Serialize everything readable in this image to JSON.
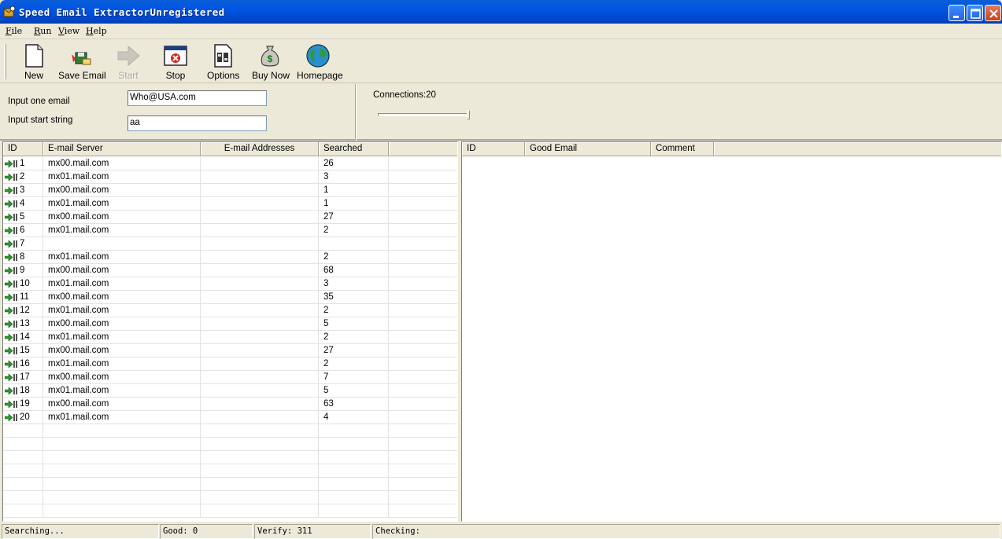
{
  "window": {
    "title": "Speed Email ExtractorUnregistered",
    "icon": "app-icon",
    "controls": [
      "minimize-icon",
      "maximize-icon",
      "close-icon"
    ]
  },
  "menu": [
    {
      "key": "F",
      "rest": "ile"
    },
    {
      "key": "R",
      "rest": "un"
    },
    {
      "key": "V",
      "rest": "iew"
    },
    {
      "key": "H",
      "rest": "elp"
    }
  ],
  "toolbar": [
    {
      "label": "New",
      "icon": "new-document-icon",
      "enabled": true
    },
    {
      "label": "Save Email",
      "icon": "save-email-icon",
      "enabled": true
    },
    {
      "label": "Start",
      "icon": "start-arrow-icon",
      "enabled": false
    },
    {
      "label": "Stop",
      "icon": "stop-window-icon",
      "enabled": true
    },
    {
      "label": "Options",
      "icon": "options-icon",
      "enabled": true
    },
    {
      "label": "Buy Now",
      "icon": "money-bag-icon",
      "enabled": true
    },
    {
      "label": "Homepage",
      "icon": "globe-icon",
      "enabled": true
    }
  ],
  "inputs": {
    "email_label": "Input one  email",
    "email_value": "Who@USA.com",
    "start_label": "Input start string",
    "start_value": "aa",
    "connections_label": "Connections:20",
    "connections_value": 20
  },
  "left_list": {
    "headers": [
      "ID",
      "E-mail Server",
      "E-mail Addresses",
      "Searched",
      ""
    ],
    "rows": [
      {
        "id": "1",
        "server": "mx00.mail.com",
        "addresses": "",
        "searched": "26"
      },
      {
        "id": "2",
        "server": "mx01.mail.com",
        "addresses": "",
        "searched": "3"
      },
      {
        "id": "3",
        "server": "mx00.mail.com",
        "addresses": "",
        "searched": "1"
      },
      {
        "id": "4",
        "server": "mx01.mail.com",
        "addresses": "",
        "searched": "1"
      },
      {
        "id": "5",
        "server": "mx00.mail.com",
        "addresses": "",
        "searched": "27"
      },
      {
        "id": "6",
        "server": "mx01.mail.com",
        "addresses": "",
        "searched": "2"
      },
      {
        "id": "7",
        "server": "",
        "addresses": "",
        "searched": ""
      },
      {
        "id": "8",
        "server": "mx01.mail.com",
        "addresses": "",
        "searched": "2"
      },
      {
        "id": "9",
        "server": "mx00.mail.com",
        "addresses": "",
        "searched": "68"
      },
      {
        "id": "10",
        "server": "mx01.mail.com",
        "addresses": "",
        "searched": "3"
      },
      {
        "id": "11",
        "server": "mx00.mail.com",
        "addresses": "",
        "searched": "35"
      },
      {
        "id": "12",
        "server": "mx01.mail.com",
        "addresses": "",
        "searched": "2"
      },
      {
        "id": "13",
        "server": "mx00.mail.com",
        "addresses": "",
        "searched": "5"
      },
      {
        "id": "14",
        "server": "mx01.mail.com",
        "addresses": "",
        "searched": "2"
      },
      {
        "id": "15",
        "server": "mx00.mail.com",
        "addresses": "",
        "searched": "27"
      },
      {
        "id": "16",
        "server": "mx01.mail.com",
        "addresses": "",
        "searched": "2"
      },
      {
        "id": "17",
        "server": "mx00.mail.com",
        "addresses": "",
        "searched": "7"
      },
      {
        "id": "18",
        "server": "mx01.mail.com",
        "addresses": "",
        "searched": "5"
      },
      {
        "id": "19",
        "server": "mx00.mail.com",
        "addresses": "",
        "searched": "63"
      },
      {
        "id": "20",
        "server": "mx01.mail.com",
        "addresses": "",
        "searched": "4"
      }
    ]
  },
  "right_list": {
    "headers": [
      "ID",
      "Good Email",
      "Comment",
      ""
    ]
  },
  "status": {
    "searching": "Searching...",
    "good": "Good: 0",
    "verify": "Verify: 311",
    "checking": "Checking:"
  }
}
